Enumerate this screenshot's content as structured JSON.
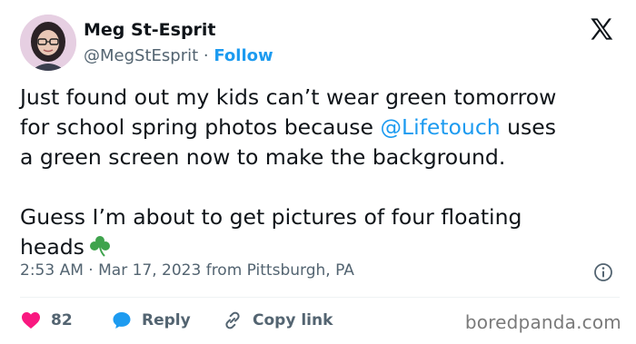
{
  "author": {
    "name": "Meg St-Esprit",
    "handle": "@MegStEsprit",
    "separator": "·",
    "follow_label": "Follow"
  },
  "tweet": {
    "line1": "Just found out my kids can’t wear green tomorrow",
    "line2_before": "for school spring photos because ",
    "line2_mention": "@Lifetouch",
    "line2_after": " uses",
    "line3": "a green screen now to make the background.",
    "para2_line1": "Guess I’m about to get pictures of four floating",
    "para2_line2": "heads"
  },
  "meta": {
    "time": "2:53 AM",
    "separator": "·",
    "date": "Mar 17, 2023",
    "location": "from Pittsburgh, PA"
  },
  "actions": {
    "likes_count": "82",
    "reply_label": "Reply",
    "copy_label": "Copy link"
  },
  "watermark": "boredpanda.com",
  "icons": {
    "platform": "x-logo-icon",
    "info": "info-icon",
    "like": "heart-icon",
    "reply": "reply-bubble-icon",
    "copy": "link-icon",
    "emoji": "shamrock-icon"
  },
  "colors": {
    "accent": "#1d9bf0",
    "like": "#f91880",
    "muted": "#536471",
    "text": "#0f1419",
    "shamrock": "#3fa34d"
  }
}
